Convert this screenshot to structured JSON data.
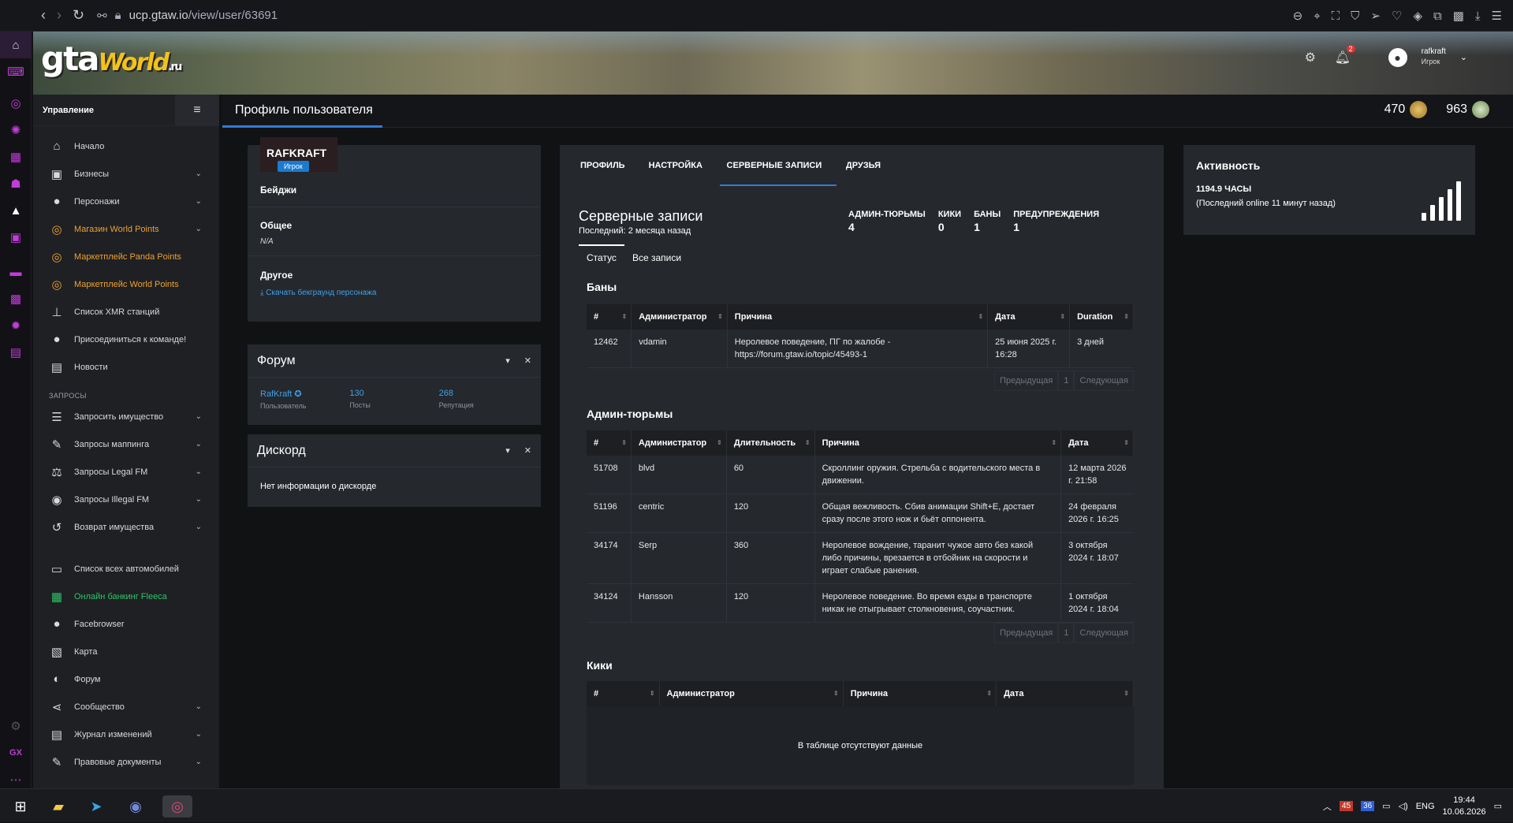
{
  "browser": {
    "url_host": "ucp.gtaw.io",
    "url_path": "/view/user/63691"
  },
  "banner": {
    "logo_main": "gta",
    "logo_script": "World",
    "logo_tld": ".ru",
    "notif_count": "2",
    "username": "rafkraft",
    "user_role": "Игрок"
  },
  "leftnav": {
    "title": "Управление",
    "items": [
      {
        "label": "Начало",
        "icon": "home-icon",
        "glyph": "⌂",
        "chev": false,
        "style": ""
      },
      {
        "label": "Бизнесы",
        "icon": "briefcase-icon",
        "glyph": "▣",
        "chev": true,
        "style": ""
      },
      {
        "label": "Персонажи",
        "icon": "user-icon",
        "glyph": "●",
        "chev": true,
        "style": ""
      },
      {
        "label": "Магазин World Points",
        "icon": "coins-icon",
        "glyph": "◎",
        "chev": true,
        "style": "gold"
      },
      {
        "label": "Маркетплейс Panda Points",
        "icon": "coins-icon",
        "glyph": "◎",
        "chev": false,
        "style": "gold"
      },
      {
        "label": "Маркетплейс World Points",
        "icon": "coins-icon",
        "glyph": "◎",
        "chev": false,
        "style": "gold"
      },
      {
        "label": "Список XMR станций",
        "icon": "antenna-icon",
        "glyph": "⊥",
        "chev": false,
        "style": ""
      },
      {
        "label": "Присоединиться к команде!",
        "icon": "user-tie-icon",
        "glyph": "●",
        "chev": false,
        "style": ""
      },
      {
        "label": "Новости",
        "icon": "newspaper-icon",
        "glyph": "▤",
        "chev": false,
        "style": ""
      }
    ],
    "section": "ЗАПРОСЫ",
    "items2": [
      {
        "label": "Запросить имущество",
        "icon": "list-icon",
        "glyph": "☰",
        "chev": true,
        "style": ""
      },
      {
        "label": "Запросы маппинга",
        "icon": "brush-icon",
        "glyph": "✎",
        "chev": true,
        "style": ""
      },
      {
        "label": "Запросы Legal FM",
        "icon": "scale-icon",
        "glyph": "⚖",
        "chev": true,
        "style": ""
      },
      {
        "label": "Запросы Illegal FM",
        "icon": "mask-icon",
        "glyph": "◉",
        "chev": true,
        "style": ""
      },
      {
        "label": "Возврат имущества",
        "icon": "undo-icon",
        "glyph": "↺",
        "chev": true,
        "style": ""
      }
    ],
    "items3": [
      {
        "label": "Список всех автомобилей",
        "icon": "car-icon",
        "glyph": "▭",
        "chev": false,
        "style": ""
      },
      {
        "label": "Онлайн банкинг Fleeca",
        "icon": "money-icon",
        "glyph": "▦",
        "chev": false,
        "style": "green"
      },
      {
        "label": "Facebrowser",
        "icon": "users-icon",
        "glyph": "●",
        "chev": false,
        "style": ""
      },
      {
        "label": "Карта",
        "icon": "map-icon",
        "glyph": "▧",
        "chev": false,
        "style": ""
      },
      {
        "label": "Форум",
        "icon": "comments-icon",
        "glyph": "◐",
        "chev": false,
        "style": ""
      },
      {
        "label": "Сообщество",
        "icon": "share-icon",
        "glyph": "⋖",
        "chev": true,
        "style": ""
      },
      {
        "label": "Журнал изменений",
        "icon": "log-icon",
        "glyph": "▤",
        "chev": true,
        "style": ""
      },
      {
        "label": "Правовые документы",
        "icon": "document-icon",
        "glyph": "✎",
        "chev": true,
        "style": ""
      }
    ]
  },
  "page": {
    "title": "Профиль пользователя",
    "points1": "470",
    "points2": "963"
  },
  "profile": {
    "name": "RAFKRAFT",
    "badge": "Игрок",
    "badges_title": "Бейджи",
    "general_title": "Общее",
    "general_value": "N/A",
    "other_title": "Другое",
    "download_link": "Скачать бекграунд персонажа"
  },
  "forum": {
    "title": "Форум",
    "user": "RafKraft",
    "user_label": "Пользователь",
    "posts": "130",
    "posts_label": "Посты",
    "rep": "268",
    "rep_label": "Репутация"
  },
  "discord": {
    "title": "Дискорд",
    "message": "Нет информации о дискорде"
  },
  "tabs": [
    "ПРОФИЛЬ",
    "НАСТРОЙКА",
    "СЕРВЕРНЫЕ ЗАПИСИ",
    "ДРУЗЬЯ"
  ],
  "records": {
    "title": "Серверные записи",
    "subtitle": "Последний: 2 месяца назад",
    "counters": [
      {
        "label": "АДМИН-ТЮРЬМЫ",
        "value": "4"
      },
      {
        "label": "КИКИ",
        "value": "0"
      },
      {
        "label": "БАНЫ",
        "value": "1"
      },
      {
        "label": "ПРЕДУПРЕЖДЕНИЯ",
        "value": "1"
      }
    ],
    "subtabs": [
      "Статус",
      "Все записи"
    ],
    "pager": {
      "prev": "Предыдущая",
      "page": "1",
      "next": "Следующая"
    },
    "bans": {
      "title": "Баны",
      "headers": [
        "#",
        "Администратор",
        "Причина",
        "Дата",
        "Duration"
      ],
      "rows": [
        [
          "12462",
          "vdamin",
          "Неролевое поведение, ПГ по жалобе - https://forum.gtaw.io/topic/45493-1",
          "25 июня 2025 г. 16:28",
          "3 дней"
        ]
      ]
    },
    "jails": {
      "title": "Админ-тюрьмы",
      "headers": [
        "#",
        "Администратор",
        "Длительность",
        "Причина",
        "Дата"
      ],
      "rows": [
        [
          "51708",
          "blvd",
          "60",
          "Скроллинг оружия. Стрельба с водительского места в движении.",
          "12 марта 2026 г. 21:58"
        ],
        [
          "51196",
          "centric",
          "120",
          "Общая вежливость. Сбив анимации Shift+E, достает сразу после этого нож и бьёт оппонента.",
          "24 февраля 2026 г. 16:25"
        ],
        [
          "34174",
          "Serp",
          "360",
          "Неролевое вождение, таранит чужое авто без какой либо причины, врезается в отбойник на скорости и играет слабые ранения.",
          "3 октября 2024 г. 18:07"
        ],
        [
          "34124",
          "Hansson",
          "120",
          "Неролевое поведение. Во время езды в транспорте никак не отыгрывает столкновения, соучастник.",
          "1 октября 2024 г. 18:04"
        ]
      ]
    },
    "kicks": {
      "title": "Кики",
      "headers": [
        "#",
        "Администратор",
        "Причина",
        "Дата"
      ],
      "empty": "В таблице отсутствуют данные"
    }
  },
  "activity": {
    "title": "Активность",
    "hours": "1194.9 ЧАСЫ",
    "last_online": "(Последний online 11 минут назад)"
  },
  "taskbar": {
    "b1": "45",
    "b2": "36",
    "lang": "ENG",
    "time": "19:44",
    "date": "10.06.2026"
  },
  "colors": {
    "accent": "#2f7bd6",
    "gold": "#f0a030",
    "green": "#2ec566",
    "badge": "#1a7bd1"
  }
}
